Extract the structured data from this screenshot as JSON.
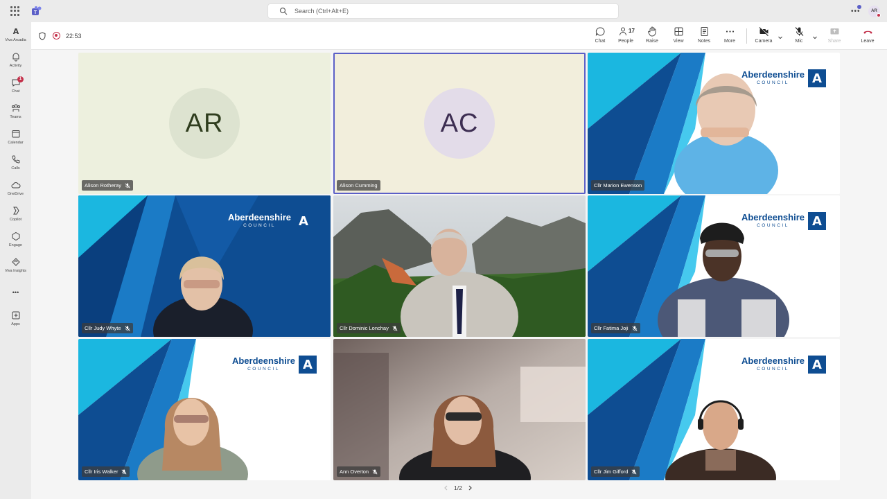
{
  "titlebar": {
    "search_placeholder": "Search (Ctrl+Alt+E)",
    "more": "•••",
    "avatar_initials": "AR"
  },
  "rail": {
    "items": [
      {
        "label": "Viva Arcadia",
        "icon": "viva-arcadia-icon"
      },
      {
        "label": "Activity",
        "icon": "bell-icon"
      },
      {
        "label": "Chat",
        "icon": "chat-icon",
        "badge": "1"
      },
      {
        "label": "Teams",
        "icon": "teams-icon"
      },
      {
        "label": "Calendar",
        "icon": "calendar-icon"
      },
      {
        "label": "Calls",
        "icon": "phone-icon"
      },
      {
        "label": "OneDrive",
        "icon": "cloud-icon"
      },
      {
        "label": "Copilot",
        "icon": "copilot-icon"
      },
      {
        "label": "Engage",
        "icon": "engage-icon"
      },
      {
        "label": "Viva Insights",
        "icon": "insights-icon"
      },
      {
        "label": "•••",
        "icon": "more-icon"
      },
      {
        "label": "Apps",
        "icon": "apps-icon"
      }
    ]
  },
  "meeting": {
    "timer": "22:53",
    "people_count": "17",
    "buttons": {
      "chat": "Chat",
      "people": "People",
      "raise": "Raise",
      "view": "View",
      "notes": "Notes",
      "more": "More",
      "camera": "Camera",
      "mic": "Mic",
      "share": "Share",
      "leave": "Leave"
    }
  },
  "council": {
    "name": "Aberdeenshire",
    "subtitle": "COUNCIL",
    "mark": "A"
  },
  "tiles": [
    {
      "name": "Alison Rotheray",
      "initials": "AR",
      "muted": true
    },
    {
      "name": "Alison Cumming",
      "initials": "AC",
      "muted": false,
      "active": true
    },
    {
      "name": "Cllr Marion Ewenson",
      "muted": false
    },
    {
      "name": "Cllr Judy Whyte",
      "muted": true
    },
    {
      "name": "Cllr Dominic Lonchay",
      "muted": true
    },
    {
      "name": "Cllr Fatima Joji",
      "muted": true
    },
    {
      "name": "Cllr Iris Walker",
      "muted": true
    },
    {
      "name": "Ann Overton",
      "muted": true
    },
    {
      "name": "Cllr Jim Gifford",
      "muted": true
    }
  ],
  "pager": {
    "label": "1/2"
  },
  "colors": {
    "brand": "#5b5fc7",
    "council_blue": "#0e4d92",
    "council_cyan": "#1bb7e0",
    "leave_red": "#c4314b"
  }
}
